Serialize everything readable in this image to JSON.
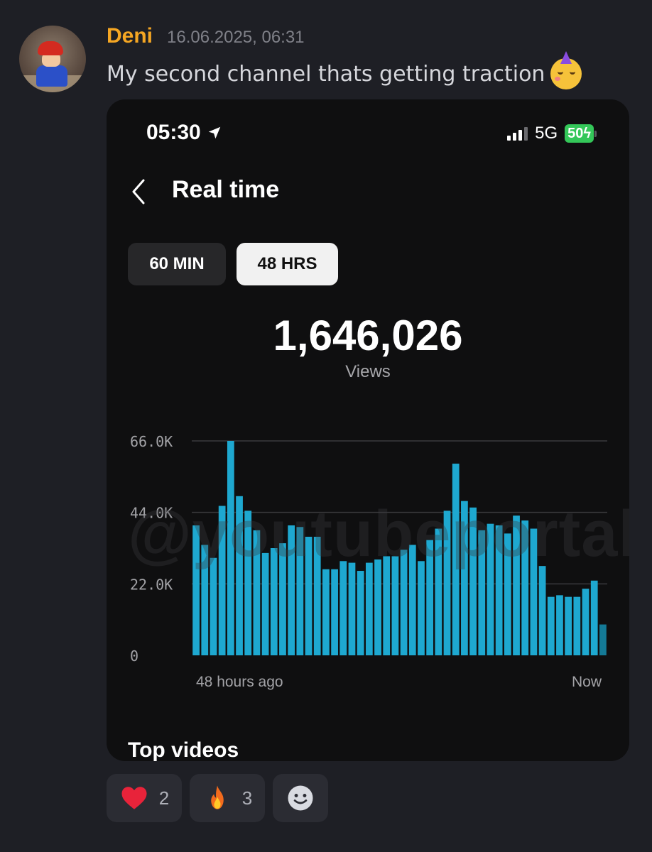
{
  "message": {
    "username": "Deni",
    "timestamp": "16.06.2025, 06:31",
    "text": "My second channel thats getting traction",
    "emoji_icon": "partying-face-icon"
  },
  "phone": {
    "status": {
      "time": "05:30",
      "network": "5G",
      "battery": "50"
    },
    "page_title": "Real time",
    "tabs": [
      {
        "label": "60 MIN",
        "selected": false
      },
      {
        "label": "48 HRS",
        "selected": true
      }
    ],
    "total_views": "1,646,026",
    "total_label": "Views",
    "watermark": "@youtubeportall",
    "section_title": "Top videos"
  },
  "chart_data": {
    "type": "bar",
    "y_tick_labels": [
      "66.0K",
      "44.0K",
      "22.0K",
      "0"
    ],
    "y_ticks": [
      66000,
      44000,
      22000,
      0
    ],
    "ylim": [
      0,
      66000
    ],
    "x_start_label": "48 hours ago",
    "x_end_label": "Now",
    "grid": true,
    "bar_color": "#1ea8d0",
    "last_bar_color": "#147a96",
    "values": [
      40000,
      34000,
      30000,
      46000,
      66000,
      49000,
      44500,
      38500,
      31500,
      33000,
      34500,
      40000,
      39500,
      36500,
      36500,
      26500,
      26500,
      29000,
      28500,
      26000,
      28500,
      29500,
      30500,
      30500,
      32500,
      34000,
      29000,
      35500,
      39000,
      44500,
      59000,
      47500,
      45500,
      38500,
      40500,
      40000,
      37500,
      43000,
      41500,
      39000,
      27500,
      18000,
      18500,
      18000,
      18000,
      20500,
      23000,
      9500
    ]
  },
  "reactions": [
    {
      "icon": "heart-icon",
      "count": "2"
    },
    {
      "icon": "fire-icon",
      "count": "3"
    },
    {
      "icon": "add-reaction-smile-icon"
    }
  ]
}
